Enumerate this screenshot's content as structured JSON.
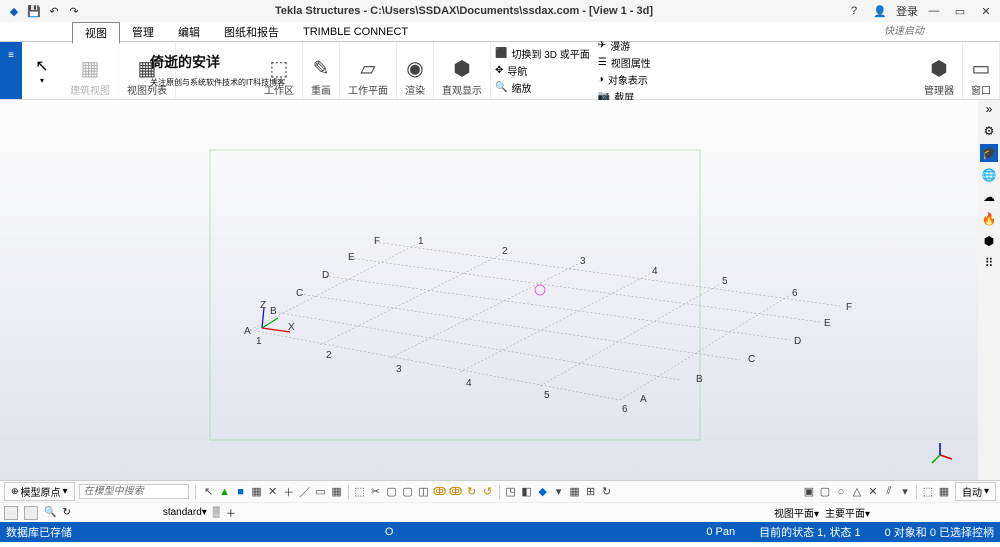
{
  "title": "Tekla Structures - C:\\Users\\SSDAX\\Documents\\ssdax.com  -  [View 1 - 3d]",
  "titlebar": {
    "login": "登录"
  },
  "tabs": {
    "active": "视图",
    "t1": "管理",
    "t2": "编辑",
    "t3": "图纸和报告",
    "t4": "TRIMBLE CONNECT"
  },
  "quicklaunch_placeholder": "快速启动",
  "ribbon": {
    "g0": "建筑视图",
    "g1": "视图列表",
    "g2": "工作区",
    "g3": "重画",
    "g4": "工作平面",
    "g5": "渲染",
    "g6": "直观显示",
    "r0": "切换到 3D 或平面",
    "r1": "导航",
    "r2": "缩放",
    "r3": "漫游",
    "r4": "视图属性",
    "r5": "对象表示",
    "r6": "截屏",
    "gmgr": "管理器",
    "gwin": "窗口"
  },
  "watermark": {
    "main": "倚逝的安详",
    "sub": "关注原创与系统软件技术的IT科技博客"
  },
  "grid": {
    "letters": [
      "A",
      "B",
      "C",
      "D",
      "E",
      "F"
    ],
    "numbers": [
      "1",
      "2",
      "3",
      "4",
      "5",
      "6"
    ],
    "axes": [
      "X",
      "Z"
    ]
  },
  "bottom": {
    "origin": "模型原点",
    "search_placeholder": "在模型中搜索",
    "standard": "standard",
    "viewplane": "视图平面",
    "mainplane": "主要平面",
    "auto": "自动"
  },
  "status": {
    "db": "数据库已存储",
    "center": "O",
    "pan": "0 Pan",
    "state": "目前的状态 1, 状态 1",
    "sel": "0 对象和 0 已选择控柄"
  }
}
